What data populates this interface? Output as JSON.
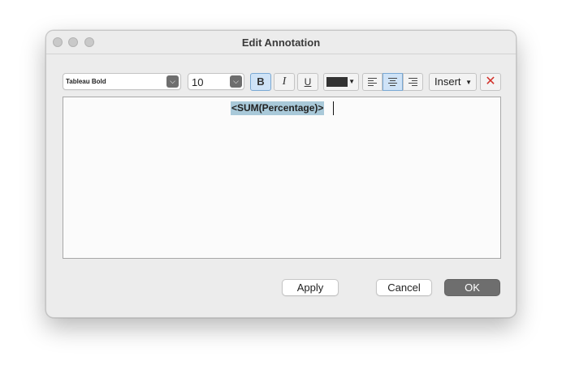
{
  "window": {
    "title": "Edit Annotation"
  },
  "toolbar": {
    "font_family": "Tableau Bold",
    "font_size": "10",
    "bold_label": "B",
    "italic_label": "I",
    "underline_label": "U",
    "text_color": "#333333",
    "insert_label": "Insert",
    "clear_glyph": "✕"
  },
  "editor": {
    "content": "<SUM(Percentage)>"
  },
  "buttons": {
    "apply": "Apply",
    "cancel": "Cancel",
    "ok": "OK"
  }
}
